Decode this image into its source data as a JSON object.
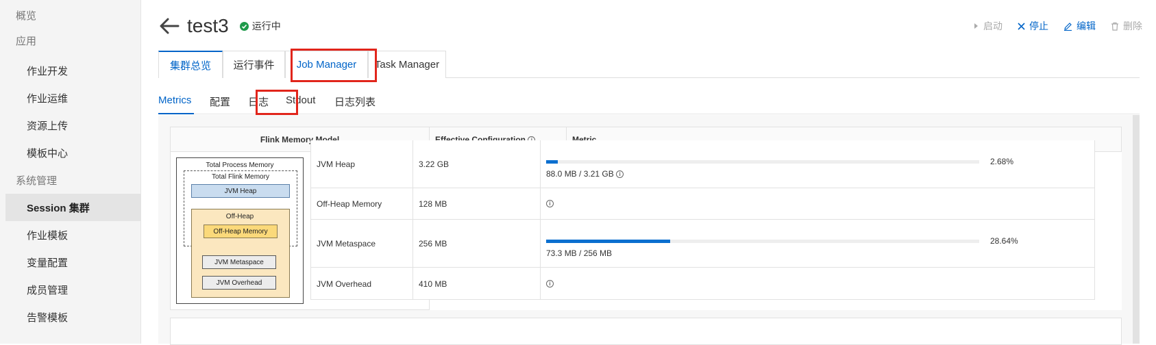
{
  "sidebar": {
    "items": [
      {
        "label": "概览",
        "kind": "group"
      },
      {
        "label": "应用",
        "kind": "group"
      },
      {
        "label": "作业开发",
        "kind": "sub"
      },
      {
        "label": "作业运维",
        "kind": "sub"
      },
      {
        "label": "资源上传",
        "kind": "sub"
      },
      {
        "label": "模板中心",
        "kind": "sub"
      },
      {
        "label": "系统管理",
        "kind": "group"
      },
      {
        "label": "Session 集群",
        "kind": "sub",
        "active": true
      },
      {
        "label": "作业模板",
        "kind": "sub"
      },
      {
        "label": "变量配置",
        "kind": "sub"
      },
      {
        "label": "成员管理",
        "kind": "sub"
      },
      {
        "label": "告警模板",
        "kind": "sub"
      }
    ]
  },
  "header": {
    "title": "test3",
    "status": "运行中",
    "status_color": "#1e9a4a"
  },
  "actions": {
    "start": "启动",
    "stop": "停止",
    "edit": "编辑",
    "delete": "删除"
  },
  "tabs_primary": [
    "集群总览",
    "运行事件",
    "Job Manager",
    "Task Manager"
  ],
  "tabs_secondary": [
    "Metrics",
    "配置",
    "日志",
    "Stdout",
    "日志列表"
  ],
  "metrics_table": {
    "headers": {
      "model": "Flink Memory Model",
      "effective": "Effective Configuration",
      "metric": "Metric"
    },
    "rows": [
      {
        "name": "JVM Heap",
        "value": "3.22 GB",
        "percent": 2.68,
        "percent_label": "2.68%",
        "usage": "88.0 MB / 3.21 GB",
        "usage_info": true
      },
      {
        "name": "Off-Heap Memory",
        "value": "128 MB"
      },
      {
        "name": "JVM Metaspace",
        "value": "256 MB",
        "percent": 28.64,
        "percent_label": "28.64%",
        "usage": "73.3 MB / 256 MB"
      },
      {
        "name": "JVM Overhead",
        "value": "410 MB"
      }
    ]
  },
  "diagram": {
    "total_process": "Total Process Memory",
    "total_flink": "Total Flink Memory",
    "jvm_heap": "JVM Heap",
    "off_heap": "Off-Heap",
    "off_heap_memory": "Off-Heap Memory",
    "jvm_metaspace": "JVM Metaspace",
    "jvm_overhead": "JVM Overhead"
  },
  "colors": {
    "accent": "#0064c8",
    "highlight_box": "#e1251b",
    "bar_fill": "#0b6fcf"
  }
}
